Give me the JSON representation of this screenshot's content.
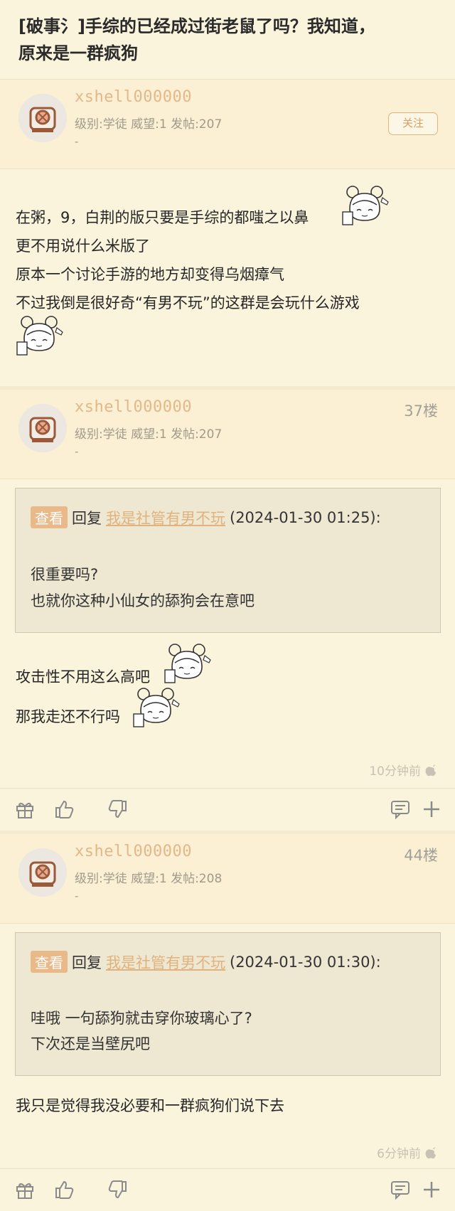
{
  "thread": {
    "title_line1": "[破事氵]手综的已经成过街老鼠了吗？我知道，",
    "title_line2": "原来是一群疯狗"
  },
  "colors": {
    "background": "#fbf4dd",
    "username": "#e2b88a",
    "accent": "#e9b98a",
    "quote_bg": "#eee8d2"
  },
  "posts": [
    {
      "username": "xshell000000",
      "meta": "级别:学徒 威望:1 发帖:207",
      "sub": "-",
      "follow_label": "关注",
      "lines": [
        "在粥，9，白荆的版只要是手综的都嗤之以鼻",
        "更不用说什么米版了",
        "原本一个讨论手游的地方却变得乌烟瘴气",
        "不过我倒是很好奇“有男不玩”的这群是会玩什么游戏"
      ]
    },
    {
      "username": "xshell000000",
      "meta": "级别:学徒 威望:1 发帖:207",
      "sub": "-",
      "floor": "37楼",
      "quote_tag": "查看",
      "quote_reply": "回复",
      "quote_user": "我是社管有男不玩",
      "quote_time": "(2024-01-30 01:25):",
      "quote_lines": [
        "很重要吗?",
        "也就你这种小仙女的舔狗会在意吧"
      ],
      "lines": [
        "攻击性不用这么高吧",
        "那我走还不行吗"
      ],
      "time": "10分钟前",
      "device_icon": "apple-icon"
    },
    {
      "username": "xshell000000",
      "meta": "级别:学徒 威望:1 发帖:208",
      "sub": "-",
      "floor": "44楼",
      "quote_tag": "查看",
      "quote_reply": "回复",
      "quote_user": "我是社管有男不玩",
      "quote_time": "(2024-01-30 01:30):",
      "quote_lines": [
        "哇哦 一句舔狗就击穿你玻璃心了?",
        "下次还是当壁尻吧"
      ],
      "lines": [
        "我只是觉得我没必要和一群疯狗们说下去"
      ],
      "time": "6分钟前",
      "device_icon": "apple-icon"
    }
  ],
  "actions": [
    "gift-icon",
    "thumbs-up-icon",
    "thumbs-down-icon",
    "comment-icon",
    "plus-icon"
  ]
}
